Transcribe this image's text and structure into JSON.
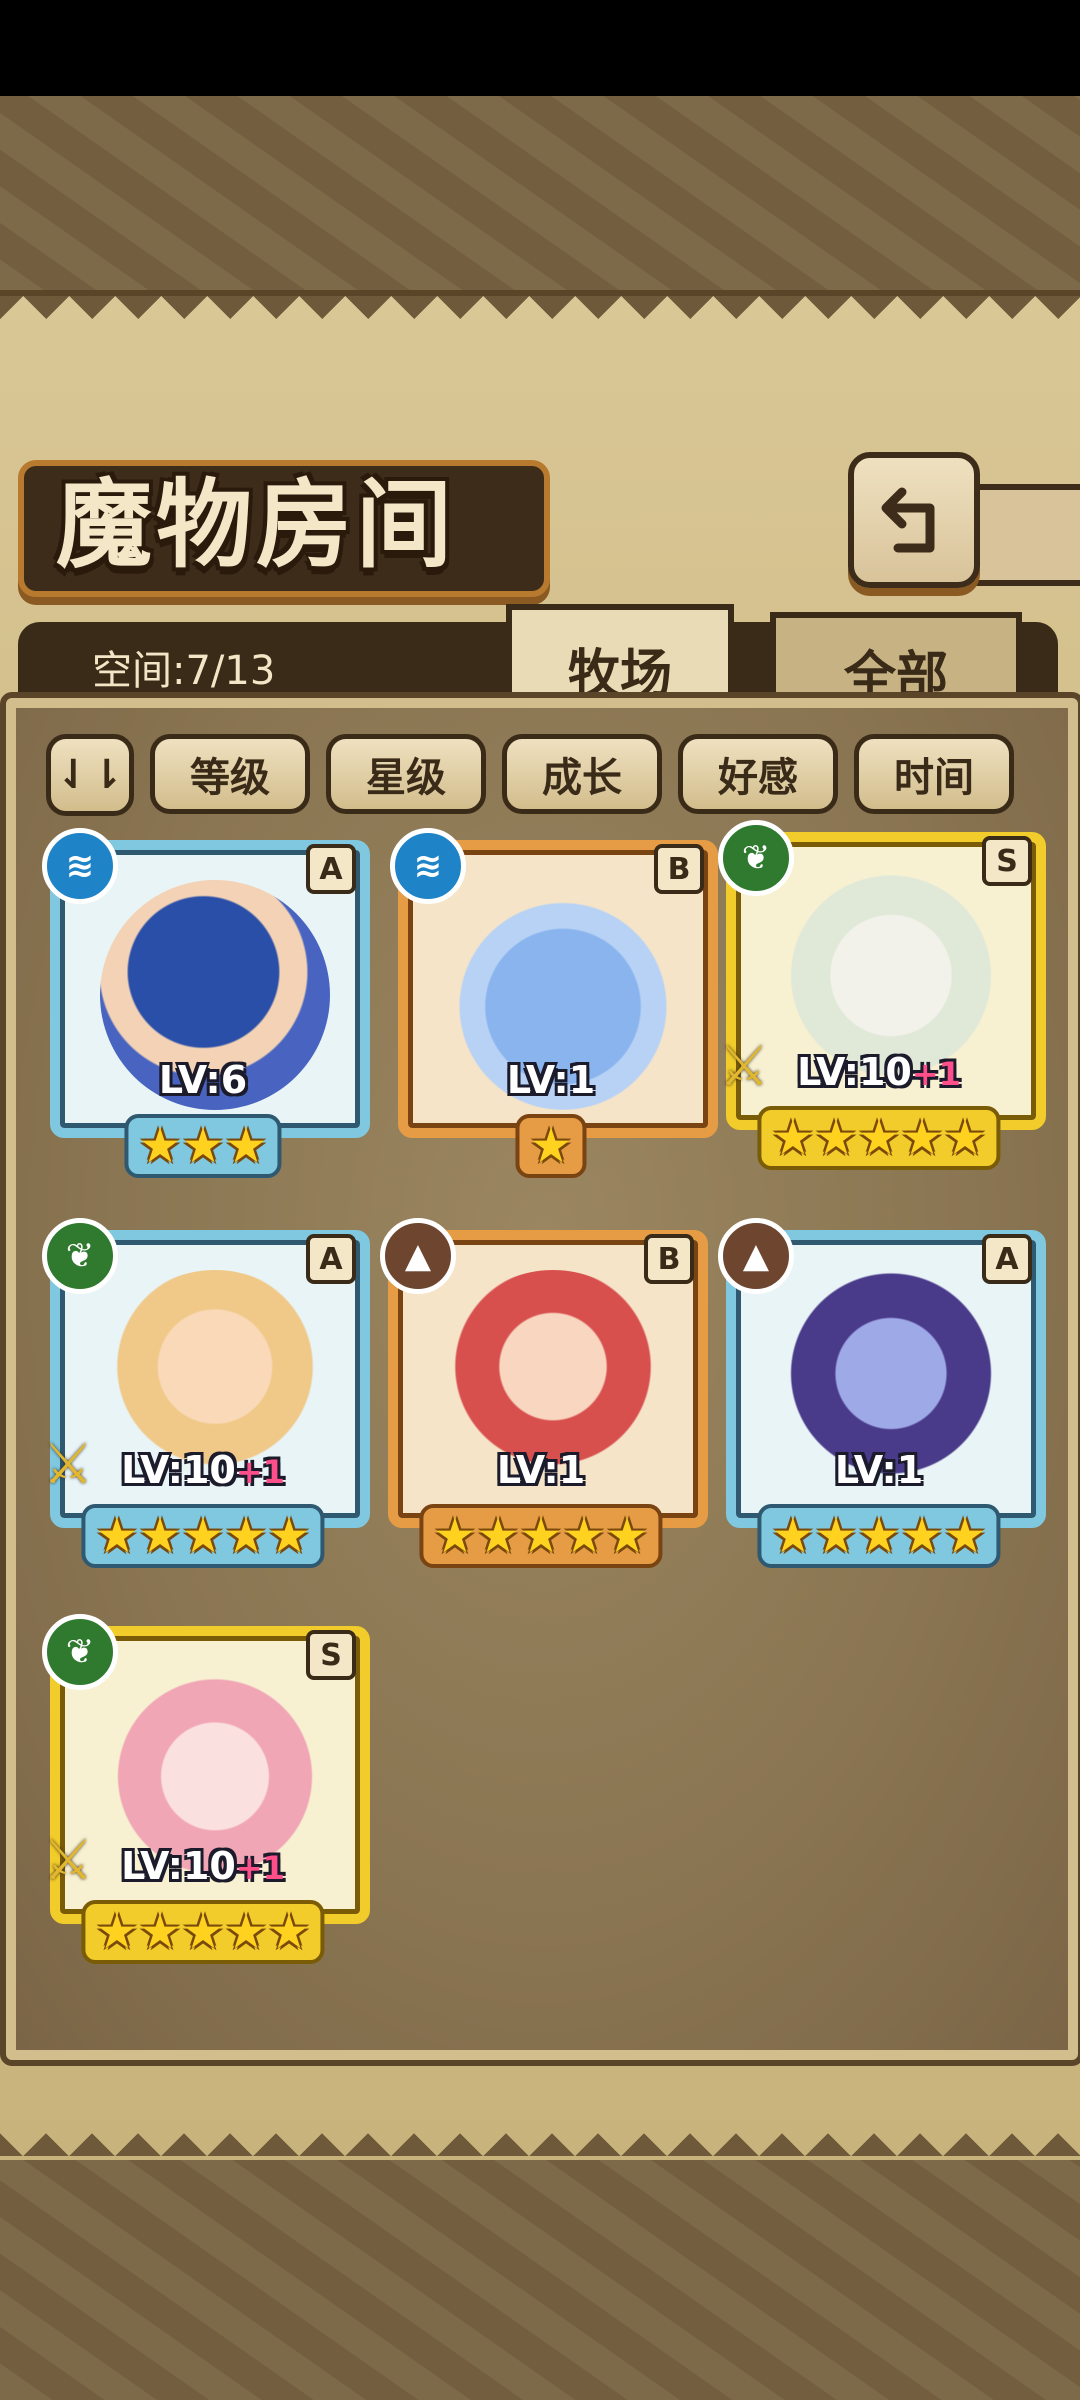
{
  "header": {
    "title": "魔物房间"
  },
  "tabs": {
    "space": "空间:7/13",
    "active": "牧场",
    "other": "全部"
  },
  "sort": {
    "toggle": "⇃⇂",
    "buttons": [
      "等级",
      "星级",
      "成长",
      "好感",
      "时间"
    ]
  },
  "icons": {
    "back": "back-arrow-icon",
    "sort_toggle": "sort-order-icon",
    "water": "water-element-icon",
    "grass": "grass-element-icon",
    "earth": "earth-element-icon",
    "weapon": "sword-icon"
  },
  "colors": {
    "rank_A": "#7fc8e0",
    "rank_B": "#e69c45",
    "rank_S": "#f1cc2a",
    "plus": "#ff4f8a"
  },
  "monsters": [
    {
      "rank": "A",
      "element": "water",
      "lv": "LV:6",
      "plus": "",
      "stars": "★★★",
      "weapon": false
    },
    {
      "rank": "B",
      "element": "water",
      "lv": "LV:1",
      "plus": "",
      "stars": "★",
      "weapon": false
    },
    {
      "rank": "S",
      "element": "grass",
      "lv": "LV:10",
      "plus": "+1",
      "stars": "★★★★★",
      "weapon": true
    },
    {
      "rank": "A",
      "element": "grass",
      "lv": "LV:10",
      "plus": "+1",
      "stars": "★★★★★",
      "weapon": true
    },
    {
      "rank": "B",
      "element": "earth",
      "lv": "LV:1",
      "plus": "",
      "stars": "★★★★★",
      "weapon": false
    },
    {
      "rank": "A",
      "element": "earth",
      "lv": "LV:1",
      "plus": "",
      "stars": "★★★★★",
      "weapon": false
    },
    {
      "rank": "S",
      "element": "grass",
      "lv": "LV:10",
      "plus": "+1",
      "stars": "★★★★★",
      "weapon": true
    }
  ]
}
